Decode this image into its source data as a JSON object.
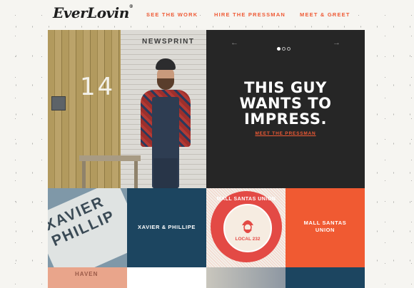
{
  "brand": {
    "logo_text": "EverLovin",
    "registered_mark": "®"
  },
  "nav": {
    "items": [
      "SEE THE WORK",
      "HIRE THE PRESSMAN",
      "MEET & GREET"
    ]
  },
  "photo": {
    "sign_text": "NEWSPRINT",
    "door_number": "14"
  },
  "hero": {
    "title_lines": [
      "THIS GUY",
      "WANTS TO",
      "IMPRESS."
    ],
    "link": "MEET THE PRESSMAN",
    "prev_arrow": "←",
    "next_arrow": "→",
    "slide_count": 3,
    "active_slide": 1
  },
  "tiles": [
    {
      "label": "",
      "art_text": "XAVIER PHILLIP"
    },
    {
      "label": "XAVIER & PHILLIPE"
    },
    {
      "seal_title": "MALL SANTAS UNION",
      "seal_local": "LOCAL 232"
    },
    {
      "label_lines": [
        "MALL SANTAS",
        "UNION"
      ]
    }
  ],
  "row3": {
    "partial_text": "HAVEN"
  },
  "colors": {
    "accent": "#ef5a35",
    "navy": "#1c4560",
    "dark": "#262626"
  }
}
